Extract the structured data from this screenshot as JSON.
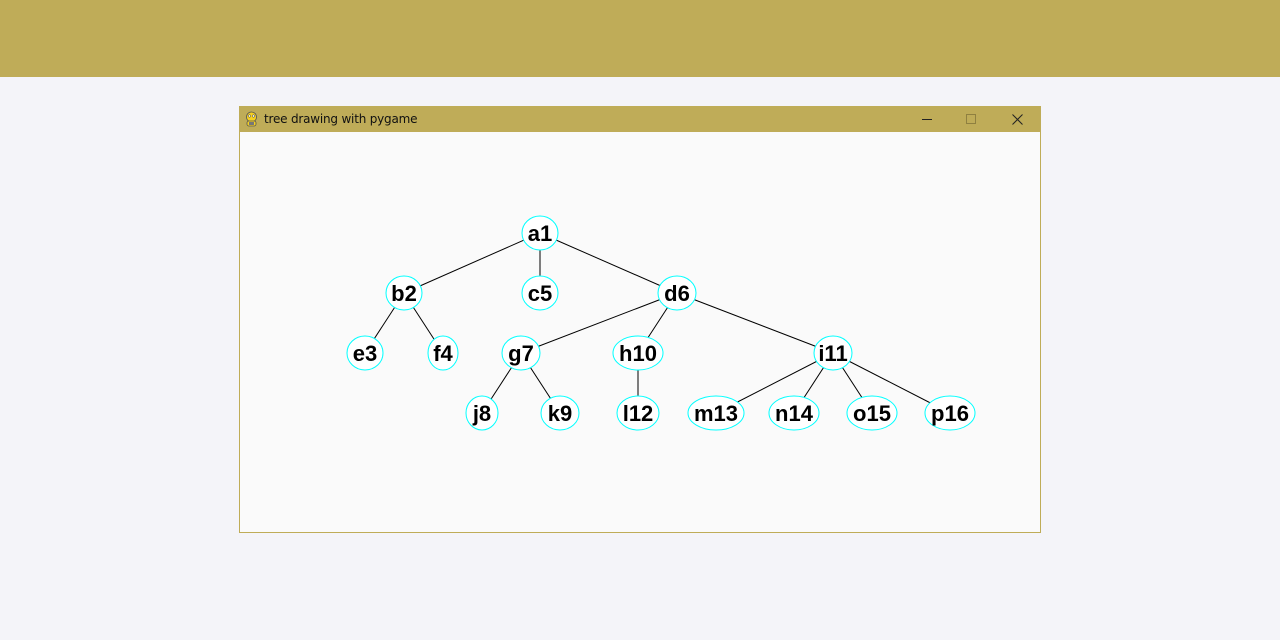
{
  "window": {
    "title": "tree drawing with pygame",
    "controls": {
      "minimize": "minimize-icon",
      "maximize": "maximize-icon",
      "close": "close-icon"
    }
  },
  "colors": {
    "titlebar": "#bfac58",
    "node_outline": "#00ffff",
    "node_fill": "#ffffff",
    "edge": "#000000",
    "canvas": "#fafafa"
  },
  "tree": {
    "nodes": [
      {
        "id": "a1",
        "label": "a1",
        "parent": null
      },
      {
        "id": "b2",
        "label": "b2",
        "parent": "a1"
      },
      {
        "id": "c5",
        "label": "c5",
        "parent": "a1"
      },
      {
        "id": "d6",
        "label": "d6",
        "parent": "a1"
      },
      {
        "id": "e3",
        "label": "e3",
        "parent": "b2"
      },
      {
        "id": "f4",
        "label": "f4",
        "parent": "b2"
      },
      {
        "id": "g7",
        "label": "g7",
        "parent": "d6"
      },
      {
        "id": "h10",
        "label": "h10",
        "parent": "d6"
      },
      {
        "id": "i11",
        "label": "i11",
        "parent": "d6"
      },
      {
        "id": "j8",
        "label": "j8",
        "parent": "g7"
      },
      {
        "id": "k9",
        "label": "k9",
        "parent": "g7"
      },
      {
        "id": "l12",
        "label": "l12",
        "parent": "h10"
      },
      {
        "id": "m13",
        "label": "m13",
        "parent": "i11"
      },
      {
        "id": "n14",
        "label": "n14",
        "parent": "i11"
      },
      {
        "id": "o15",
        "label": "o15",
        "parent": "i11"
      },
      {
        "id": "p16",
        "label": "p16",
        "parent": "i11"
      }
    ]
  }
}
